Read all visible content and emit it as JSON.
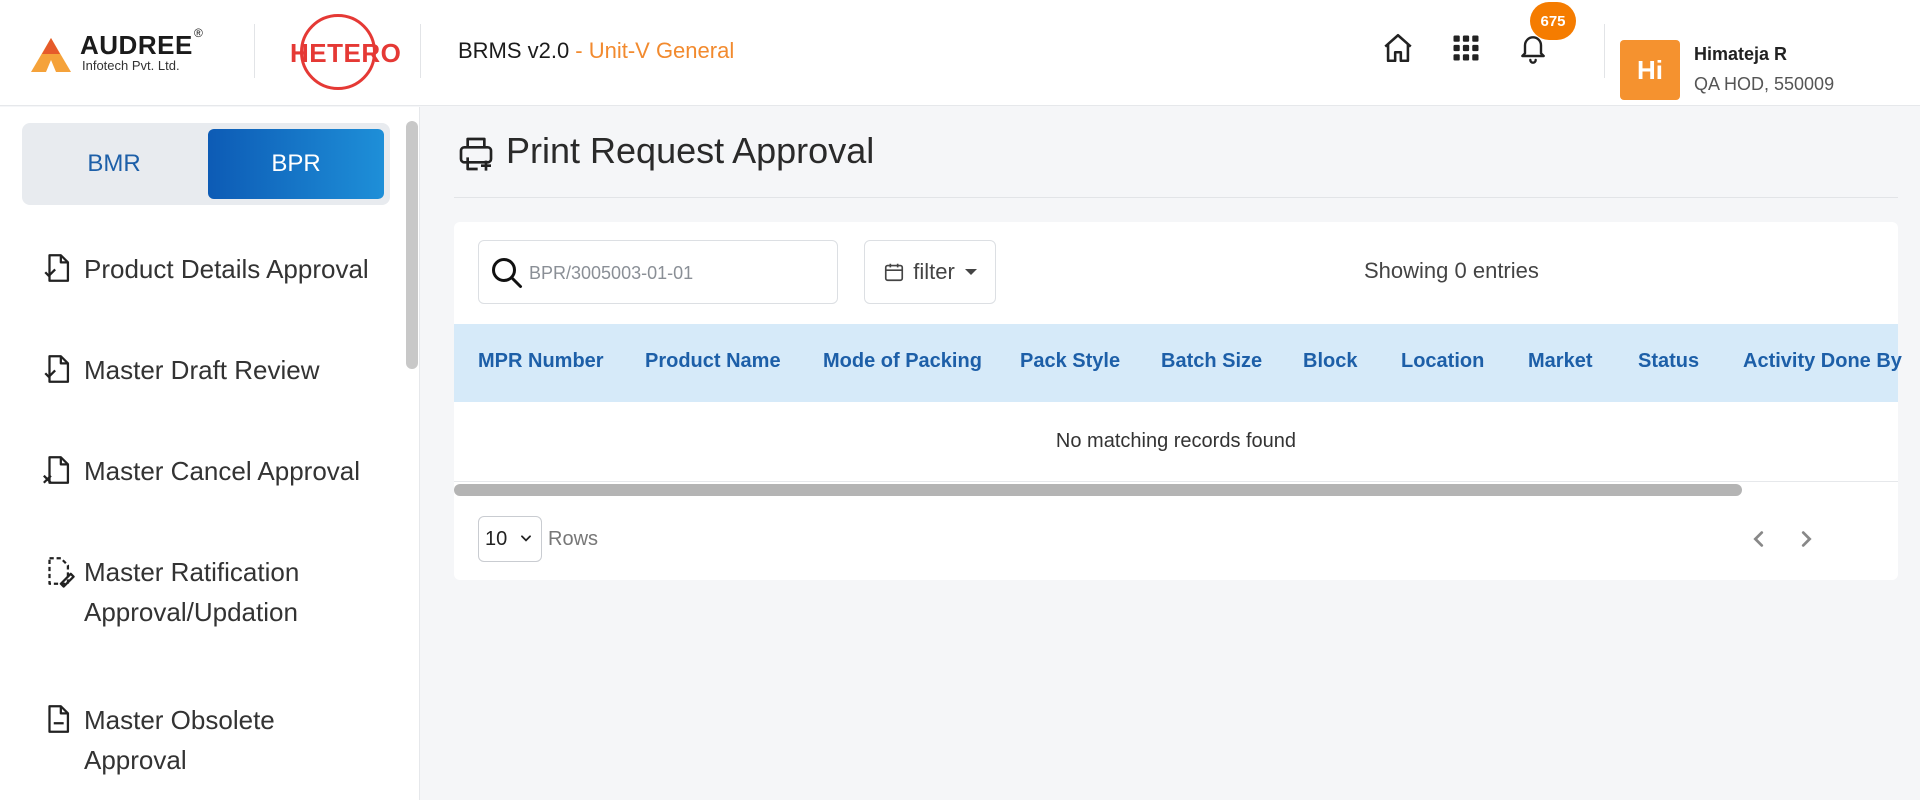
{
  "header": {
    "audree_brand": "AUDREE",
    "audree_reg": "®",
    "audree_sub": "Infotech Pvt. Ltd.",
    "hetero_logo": "HETERO",
    "app_name": "BRMS v2.0",
    "unit": "- Unit-V General",
    "notification_count": "675",
    "avatar_initials": "Hi",
    "user_name": "Himateja R",
    "user_role": "QA HOD, 550009",
    "icons": [
      "home-icon",
      "apps-grid-icon",
      "bell-icon"
    ]
  },
  "sidebar": {
    "toggle": {
      "left": "BMR",
      "right": "BPR",
      "active": "BPR"
    },
    "items": [
      {
        "label": "Product Details Approval",
        "icon": "document-check-icon"
      },
      {
        "label": "Master Draft Review",
        "icon": "document-check-icon"
      },
      {
        "label": "Master Cancel Approval",
        "icon": "document-cancel-icon"
      },
      {
        "label": "Master Ratification Approval/Updation",
        "icon": "document-edit-icon"
      },
      {
        "label": "Master Obsolete Approval",
        "icon": "document-minus-icon"
      }
    ]
  },
  "main": {
    "title": "Print Request Approval",
    "title_icon": "printer-add-icon",
    "search_placeholder": "BPR/3005003-01-01",
    "filter_label": "filter",
    "showing_text": "Showing 0 entries",
    "columns": [
      "MPR Number",
      "Product Name",
      "Mode of Packing",
      "Pack Style",
      "Batch Size",
      "Block",
      "Location",
      "Market",
      "Status",
      "Activity Done By"
    ],
    "empty_message": "No matching records found",
    "rows_per_page": "10",
    "rows_label": "Rows"
  },
  "colors": {
    "accent_blue": "#1d5fa8",
    "orange": "#f28a2e",
    "table_header_bg": "#d6eaf9",
    "hetero_red": "#e53935"
  }
}
